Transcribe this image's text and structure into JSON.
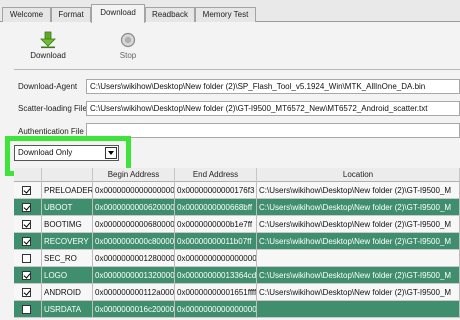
{
  "tabs": [
    {
      "label": "Welcome"
    },
    {
      "label": "Format"
    },
    {
      "label": "Download"
    },
    {
      "label": "Readback"
    },
    {
      "label": "Memory Test"
    }
  ],
  "toolbar": {
    "download_label": "Download",
    "stop_label": "Stop",
    "download_icon": "download-arrow-icon",
    "stop_icon": "stop-icon"
  },
  "fields": {
    "download_agent_label": "Download-Agent",
    "download_agent_value": "C:\\Users\\wikihow\\Desktop\\New folder (2)\\SP_Flash_Tool_v5.1924_Win\\MTK_AllInOne_DA.bin",
    "scatter_label": "Scatter-loading File",
    "scatter_value": "C:\\Users\\wikihow\\Desktop\\New folder (2)\\GT-I9500_MT6572_New\\MT6572_Android_scatter.txt",
    "auth_label": "Authentication File",
    "auth_value": ""
  },
  "mode_dropdown": {
    "selected": "Download Only"
  },
  "table": {
    "columns": [
      "",
      "",
      "Begin Address",
      "End Address",
      "Location"
    ],
    "rows": [
      {
        "checked": true,
        "name": "PRELOADER",
        "begin": "0x0000000000000000",
        "end": "0x00000000000176f3",
        "location": "C:\\Users\\wikihow\\Desktop\\New folder (2)\\GT-I9500_M"
      },
      {
        "checked": true,
        "name": "UBOOT",
        "begin": "0x0000000000620000",
        "end": "0x0000000000668bff",
        "location": "C:\\Users\\wikihow\\Desktop\\New folder (2)\\GT-I9500_M"
      },
      {
        "checked": true,
        "name": "BOOTIMG",
        "begin": "0x0000000000680000",
        "end": "0x0000000000b1e7ff",
        "location": "C:\\Users\\wikihow\\Desktop\\New folder (2)\\GT-I9500_M"
      },
      {
        "checked": true,
        "name": "RECOVERY",
        "begin": "0x0000000000c80000",
        "end": "0x00000000011b07ff",
        "location": "C:\\Users\\wikihow\\Desktop\\New folder (2)\\GT-I9500_M"
      },
      {
        "checked": false,
        "name": "SEC_RO",
        "begin": "0x0000000001280000",
        "end": "0x0000000000000000",
        "location": ""
      },
      {
        "checked": true,
        "name": "LOGO",
        "begin": "0x0000000001320000",
        "end": "0x00000000013364cdf",
        "location": "C:\\Users\\wikihow\\Desktop\\New folder (2)\\GT-I9500_M"
      },
      {
        "checked": true,
        "name": "ANDROID",
        "begin": "0x000000000112a0000",
        "end": "0x00000000001651ffff",
        "location": "C:\\Users\\wikihow\\Desktop\\New folder (2)\\GT-I9500_M"
      },
      {
        "checked": false,
        "name": "USRDATA",
        "begin": "0x0000000016c20000",
        "end": "0x0000000000000000",
        "location": ""
      }
    ]
  },
  "colors": {
    "highlight": "#3ee43a",
    "row_selected": "#3f8f6f"
  }
}
